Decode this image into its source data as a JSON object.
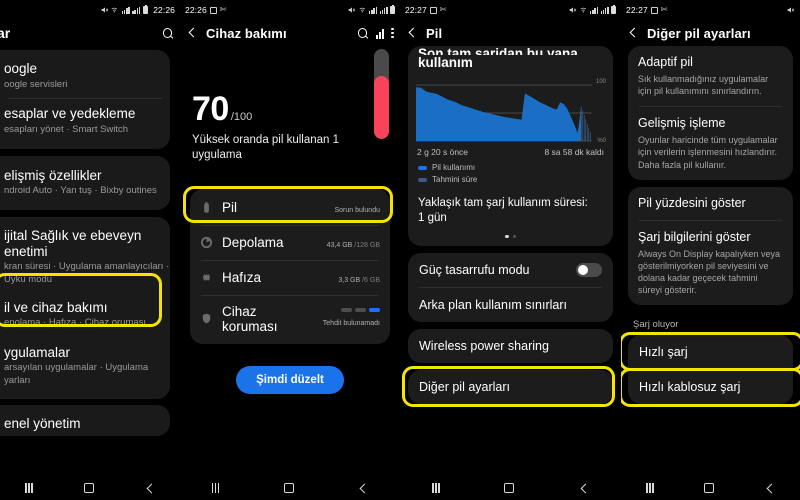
{
  "panels": {
    "settings": {
      "status": {
        "time": "22:26"
      },
      "appbar": {
        "title": "ar",
        "search_icon": "search-icon"
      },
      "items": [
        {
          "title": "oogle",
          "subtitle": "oogle servisleri",
          "highlighted": false
        },
        {
          "title": "esaplar ve yedekleme",
          "subtitle": "esapları yönet  ·  Smart Switch",
          "highlighted": false
        },
        {
          "title": "elişmiş özellikler",
          "subtitle": "ndroid Auto  ·  Yan tuş  ·  Bixby outines",
          "highlighted": false
        },
        {
          "title": "ijital Sağlık ve ebeveyn enetimi",
          "subtitle": "kran süresi  ·  Uygulama amanlayıcıları  ·  Uyku modu",
          "highlighted": false
        },
        {
          "title": "il ve cihaz bakımı",
          "subtitle": "epolama  ·  Hafıza  ·  Cihaz oruması",
          "highlighted": true
        },
        {
          "title": "ygulamalar",
          "subtitle": "arsayılan uygulamalar  ·  Uygulama yarları",
          "highlighted": false
        },
        {
          "title": "enel yönetim",
          "subtitle": "",
          "highlighted": false
        }
      ]
    },
    "device_care": {
      "status": {
        "time": "22:26"
      },
      "appbar": {
        "title": "Cihaz bakımı",
        "icons": [
          "search-icon",
          "bar-chart-icon",
          "kebab-menu-icon"
        ]
      },
      "score": {
        "value": "70",
        "denominator": "/100",
        "summary": "Yüksek oranda pil kullanan 1 uygulama",
        "battery_level_percent": 70
      },
      "rows": [
        {
          "icon": "battery-icon",
          "name": "Pil",
          "status": "Sorun bulundu",
          "bar_percent": 30,
          "bar_color": "#f8435a",
          "type": "bar",
          "highlighted": true
        },
        {
          "icon": "storage-icon",
          "name": "Depolama",
          "status": "43,4 GB",
          "status_dim": " /128 GB",
          "bar_percent": 34,
          "bar_color": "#21b765",
          "type": "bar",
          "highlighted": false
        },
        {
          "icon": "memory-icon",
          "name": "Hafıza",
          "status": "3,3 GB",
          "status_dim": " /6 GB",
          "bar_percent": 55,
          "bar_color": "#21b765",
          "type": "bar",
          "highlighted": false
        },
        {
          "icon": "shield-icon",
          "name": "Cihaz koruması",
          "status": "Tehdit bulunamadı",
          "type": "dots",
          "dots_on_index": 2,
          "dot_color": "#1a73ff",
          "highlighted": false
        }
      ],
      "fix_button": "Şimdi düzelt"
    },
    "battery": {
      "status": {
        "time": "22:27"
      },
      "appbar": {
        "title": "Pil"
      },
      "heading_clipped": "Son tam şarjdan bu yana",
      "heading": "kullanım",
      "chart_caption_left": "2 g 20 s önce",
      "chart_caption_right": "8 sa 58 dk kaldı",
      "legend": [
        {
          "label": "Pil kullanımı",
          "color": "#1a73e8"
        },
        {
          "label": "Tahmini süre",
          "color": "#3a5a88"
        }
      ],
      "estimate_label": "Yaklaşık tam şarj kullanım süresi:",
      "estimate_value": "1 gün",
      "pager": {
        "pages": 2,
        "active": 0
      },
      "rows": [
        {
          "label": "Güç tasarrufu modu",
          "type": "toggle",
          "toggle_on": false,
          "highlighted": false
        },
        {
          "label": "Arka plan kullanım sınırları",
          "type": "link",
          "highlighted": false
        },
        {
          "label": "Wireless power sharing",
          "type": "link",
          "highlighted": false
        },
        {
          "label": "Diğer pil ayarları",
          "type": "link",
          "highlighted": true
        }
      ]
    },
    "other_battery": {
      "status": {
        "time": "22:27"
      },
      "appbar": {
        "title": "Diğer pil ayarları"
      },
      "group1": [
        {
          "title": "Adaptif pil",
          "subtitle": "Sık kullanmadığınız uygulamalar için pil kullanımını sınırlandırın."
        },
        {
          "title": "Gelişmiş işleme",
          "subtitle": "Oyunlar haricinde tüm uygulamalar için verilerin işlenmesini hızlandırır. Daha fazla pil kullanır."
        }
      ],
      "group2": [
        {
          "title": "Pil yüzdesini göster",
          "subtitle": ""
        },
        {
          "title": "Şarj bilgilerini göster",
          "subtitle": "Always On Display kapalıyken veya gösterilmiyorken pil seviyesini ve dolana kadar geçecek tahmini süreyi gösterir."
        }
      ],
      "section_header": "Şarj oluyor",
      "charging_items": [
        {
          "label": "Hızlı şarj",
          "highlighted": true
        },
        {
          "label": "Hızlı kablosuz şarj",
          "highlighted": true
        }
      ]
    }
  },
  "navbar": {
    "recent_icon": "recent-apps-icon",
    "home_icon": "home-icon",
    "back_icon": "back-icon"
  },
  "colors": {
    "highlight": "#f5e400",
    "accent_blue": "#1a73e8",
    "danger_red": "#f8435a",
    "ok_green": "#21b765"
  },
  "chart_data": {
    "type": "area",
    "title": "Son tam şarjdan bu yana kullanım",
    "xlabel": "",
    "ylabel": "",
    "ylim": [
      0,
      100
    ],
    "tick_labels_y": [
      "100",
      "%0"
    ],
    "x_start_label": "2 g 20 s önce",
    "x_end_label": "8 sa 58 dk kaldı",
    "legend": [
      "Pil kullanımı",
      "Tahmini süre"
    ],
    "series": [
      {
        "name": "Pil kullanımı",
        "color": "#1a73e8",
        "x": [
          0,
          3,
          6,
          9,
          12,
          15,
          18,
          22,
          26,
          30,
          34,
          38,
          42,
          46,
          50,
          54,
          58,
          60,
          62,
          66,
          70,
          74,
          78,
          80,
          82,
          84,
          86,
          88,
          90,
          92,
          94
        ],
        "values": [
          96,
          95,
          88,
          86,
          84,
          79,
          74,
          70,
          64,
          60,
          56,
          52,
          49,
          46,
          43,
          41,
          39,
          38,
          85,
          78,
          70,
          64,
          58,
          56,
          69,
          66,
          58,
          44,
          30,
          14,
          62
        ]
      },
      {
        "name": "Tahmini süre",
        "color": "#3a5a88",
        "x": [
          94,
          96,
          98,
          100
        ],
        "values": [
          62,
          44,
          26,
          8
        ]
      }
    ]
  }
}
